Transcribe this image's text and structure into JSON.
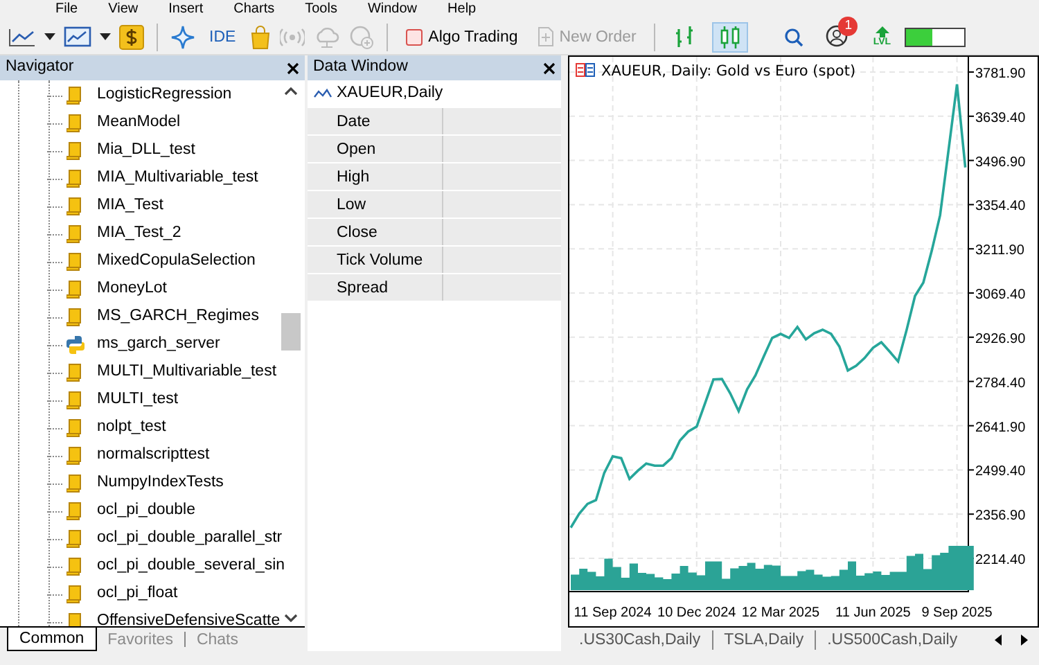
{
  "menu": [
    "File",
    "View",
    "Insert",
    "Charts",
    "Tools",
    "Window",
    "Help"
  ],
  "toolbar": {
    "ide_label": "IDE",
    "algo_trading": {
      "label": "Algo Trading",
      "on": false
    },
    "new_order": {
      "label": "New Order",
      "disabled": true
    },
    "chart_types": [
      {
        "selected": false
      },
      {
        "selected": true
      }
    ],
    "notifications_badge": "1",
    "level_label": "LVL",
    "level": 0.45
  },
  "navigator": {
    "title": "Navigator",
    "items": [
      {
        "label": "LogisticRegression",
        "kind": "script"
      },
      {
        "label": "MeanModel",
        "kind": "script"
      },
      {
        "label": "Mia_DLL_test",
        "kind": "script"
      },
      {
        "label": "MIA_Multivariable_test",
        "kind": "script"
      },
      {
        "label": "MIA_Test",
        "kind": "script"
      },
      {
        "label": "MIA_Test_2",
        "kind": "script"
      },
      {
        "label": "MixedCopulaSelection",
        "kind": "script"
      },
      {
        "label": "MoneyLot",
        "kind": "script"
      },
      {
        "label": "MS_GARCH_Regimes",
        "kind": "script"
      },
      {
        "label": "ms_garch_server",
        "kind": "python"
      },
      {
        "label": "MULTI_Multivariable_test",
        "kind": "script"
      },
      {
        "label": "MULTI_test",
        "kind": "script"
      },
      {
        "label": "nolpt_test",
        "kind": "script"
      },
      {
        "label": "normalscripttest",
        "kind": "script"
      },
      {
        "label": "NumpyIndexTests",
        "kind": "script"
      },
      {
        "label": "ocl_pi_double",
        "kind": "script"
      },
      {
        "label": "ocl_pi_double_parallel_str",
        "kind": "script"
      },
      {
        "label": "ocl_pi_double_several_sin",
        "kind": "script"
      },
      {
        "label": "ocl_pi_float",
        "kind": "script"
      },
      {
        "label": "OffensiveDefensiveScatte",
        "kind": "script"
      }
    ],
    "tabs": [
      {
        "label": "Common",
        "selected": true
      },
      {
        "label": "Favorites",
        "selected": false
      },
      {
        "label": "Chats",
        "selected": false
      }
    ]
  },
  "data_window": {
    "title": "Data Window",
    "symbol": "XAUEUR,Daily",
    "rows": [
      {
        "label": "Date"
      },
      {
        "label": "Open"
      },
      {
        "label": "High"
      },
      {
        "label": "Low"
      },
      {
        "label": "Close"
      },
      {
        "label": "Tick Volume"
      },
      {
        "label": "Spread"
      }
    ]
  },
  "chart": {
    "chart_data": {
      "type": "line",
      "title": "XAUEUR, Daily:  Gold vs Euro (spot)",
      "categories": [
        null,
        null,
        null,
        null,
        null,
        "11 Sep 2024",
        null,
        null,
        null,
        null,
        null,
        null,
        null,
        null,
        null,
        "10 Dec 2024",
        null,
        null,
        null,
        null,
        null,
        null,
        null,
        null,
        null,
        "12 Mar 2025",
        null,
        null,
        null,
        null,
        null,
        null,
        null,
        null,
        null,
        null,
        "11 Jun 2025",
        null,
        null,
        null,
        null,
        null,
        null,
        null,
        null,
        null,
        "9 Sep 2025",
        null
      ],
      "ylim": [
        2111.6,
        3831.0
      ],
      "grid": true,
      "series": [
        {
          "color": "#26a69a",
          "values": [
            2313,
            2358,
            2390,
            2402,
            2490,
            2543,
            2537,
            2470,
            2497,
            2520,
            2513,
            2513,
            2537,
            2594,
            2623,
            2639,
            2715,
            2791,
            2792,
            2746,
            2689,
            2759,
            2804,
            2866,
            2925,
            2938,
            2925,
            2960,
            2920,
            2940,
            2951,
            2938,
            2897,
            2820,
            2835,
            2860,
            2893,
            2911,
            2880,
            2849,
            2950,
            3060,
            3103,
            3206,
            3320,
            3530,
            3742,
            3474
          ]
        }
      ],
      "yticks": [
        {
          "value": 3781.9,
          "label": "3781.90"
        },
        {
          "value": 3639.4,
          "label": "3639.40"
        },
        {
          "value": 3496.9,
          "label": "3496.90"
        },
        {
          "value": 3354.4,
          "label": "3354.40"
        },
        {
          "value": 3211.9,
          "label": "3211.90"
        },
        {
          "value": 3069.4,
          "label": "3069.40"
        },
        {
          "value": 2926.9,
          "label": "2926.90"
        },
        {
          "value": 2784.4,
          "label": "2784.40"
        },
        {
          "value": 2641.9,
          "label": "2641.90"
        },
        {
          "value": 2499.4,
          "label": "2499.40"
        },
        {
          "value": 2356.9,
          "label": "2356.90"
        },
        {
          "value": 2214.4,
          "label": "2214.40"
        }
      ]
    },
    "tabs": [
      {
        "label": ".US30Cash,Daily",
        "selected": false
      },
      {
        "label": "TSLA,Daily",
        "selected": false
      },
      {
        "label": ".US500Cash,Daily",
        "selected": false
      }
    ]
  }
}
